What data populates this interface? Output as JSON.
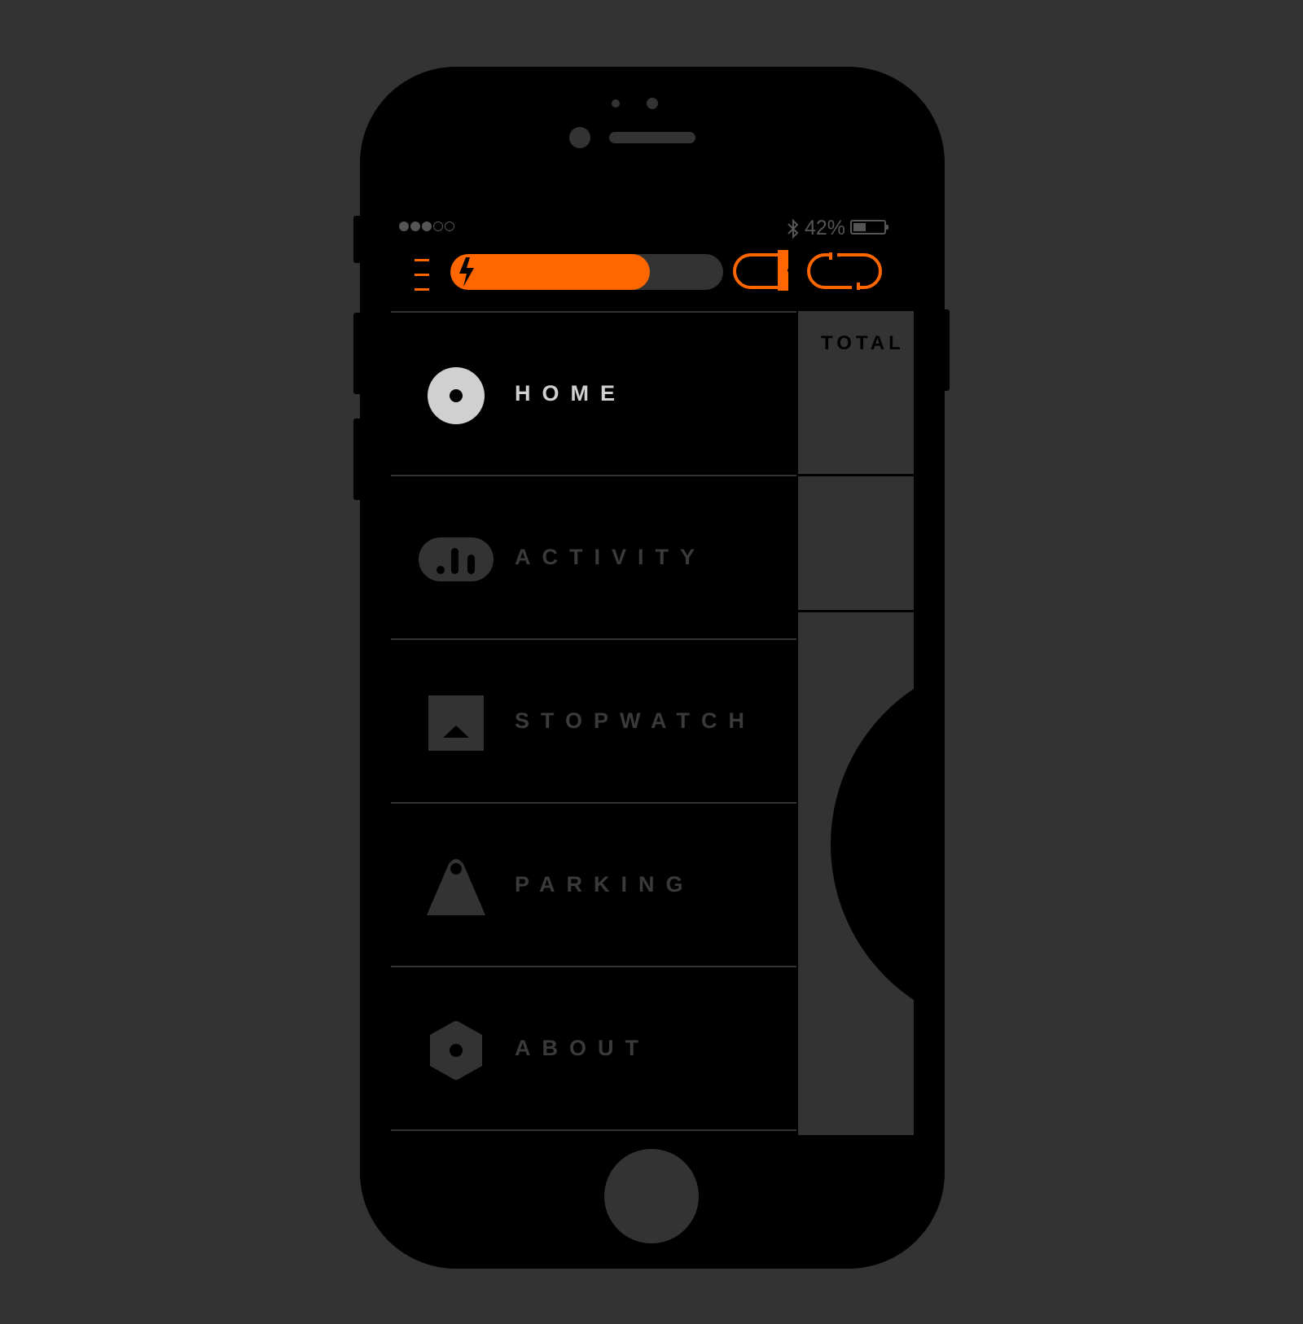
{
  "statusbar": {
    "signal_on": 3,
    "signal_off": 2,
    "battery_percent_label": "42%",
    "battery_level": 0.42
  },
  "toolbar": {
    "charge_level": 0.73,
    "accent_color": "#ff6600"
  },
  "menu": {
    "items": [
      {
        "label": "HOME",
        "icon": "home-dot-circle-icon",
        "active": true
      },
      {
        "label": "ACTIVITY",
        "icon": "activity-bars-icon",
        "active": false
      },
      {
        "label": "STOPWATCH",
        "icon": "stopwatch-triangle-icon",
        "active": false
      },
      {
        "label": "PARKING",
        "icon": "parking-pin-icon",
        "active": false
      },
      {
        "label": "ABOUT",
        "icon": "about-hexagon-icon",
        "active": false
      }
    ]
  },
  "panel": {
    "total_label": "TOTAL"
  },
  "colors": {
    "background": "#333333",
    "device": "#000000",
    "accent": "#ff6600",
    "active_text": "#d0d0d0",
    "inactive_text": "#3a3a3a"
  }
}
